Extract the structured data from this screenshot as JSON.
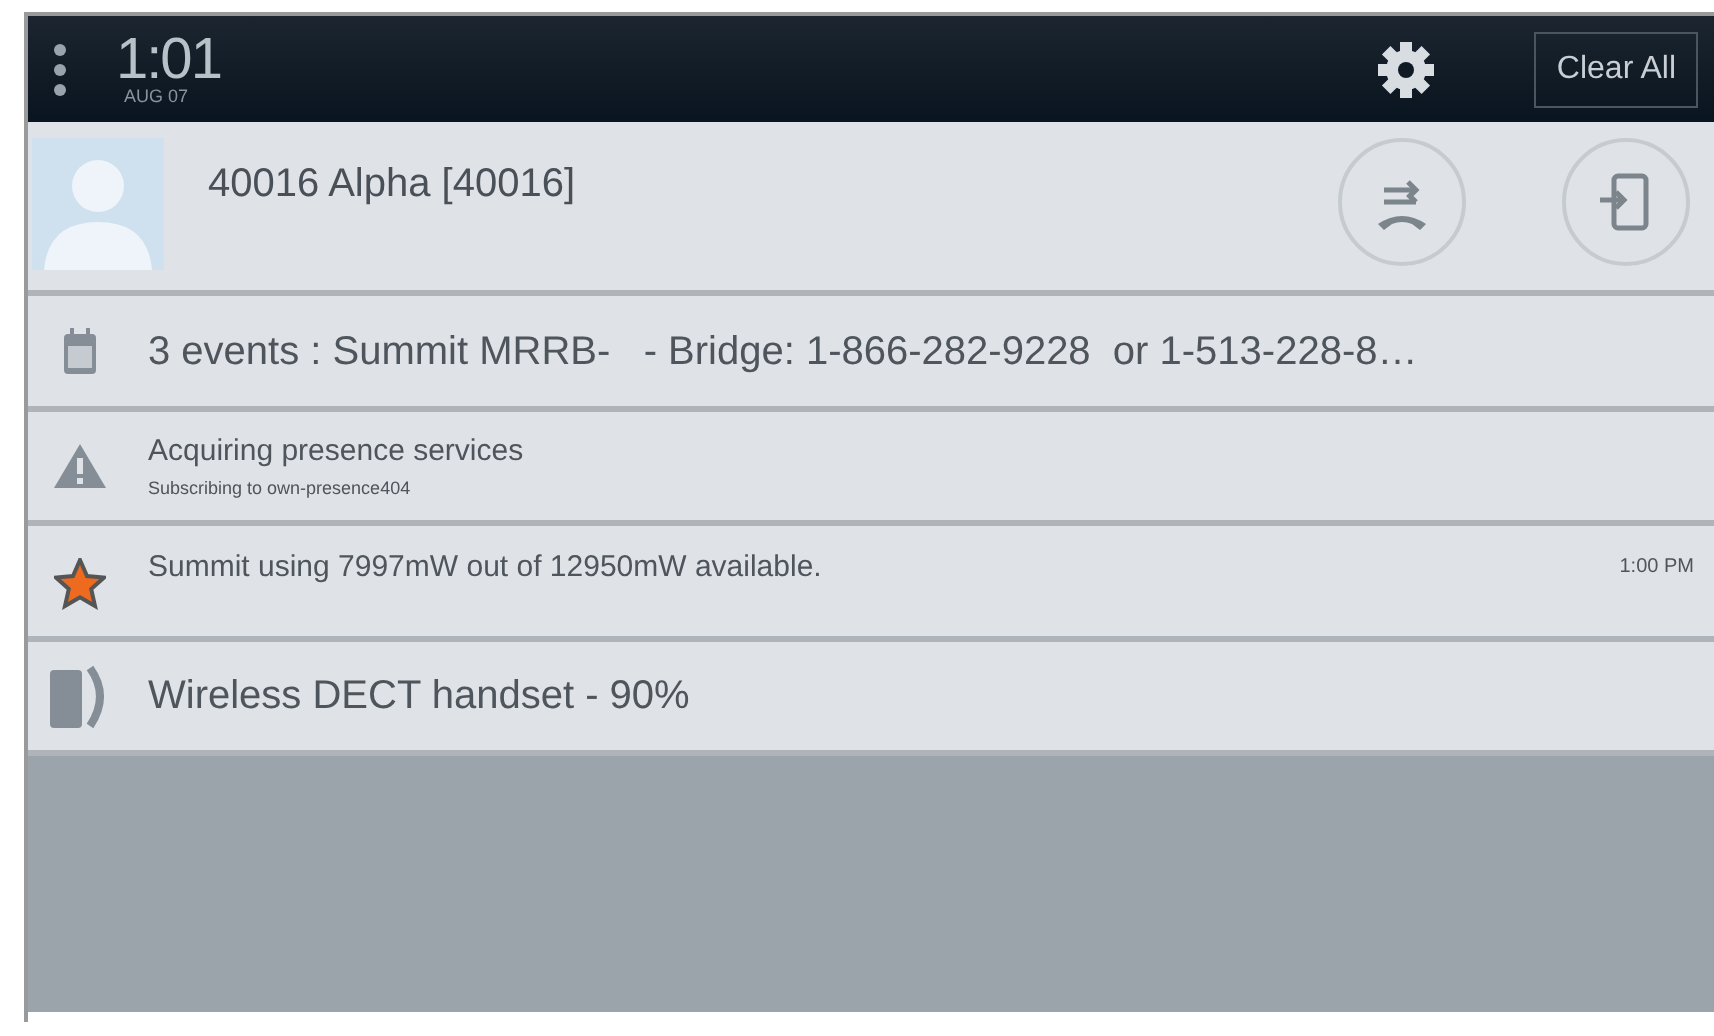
{
  "status_bar": {
    "time": "1:01",
    "date": "AUG 07",
    "clear_button": "Clear All"
  },
  "contact": {
    "name": "40016 Alpha [40016]"
  },
  "notifications": [
    {
      "kind": "calendar",
      "title": "3 events : Summit MRRB-   - Bridge: 1-866-282-9228  or 1-513-228-8…"
    },
    {
      "kind": "warning",
      "title": "Acquiring presence services",
      "subtitle": "Subscribing to own-presence404"
    },
    {
      "kind": "star",
      "title": "Summit using 7997mW out of 12950mW available.",
      "time": "1:00 PM"
    },
    {
      "kind": "battery",
      "title": "Wireless DECT handset - 90%"
    }
  ]
}
